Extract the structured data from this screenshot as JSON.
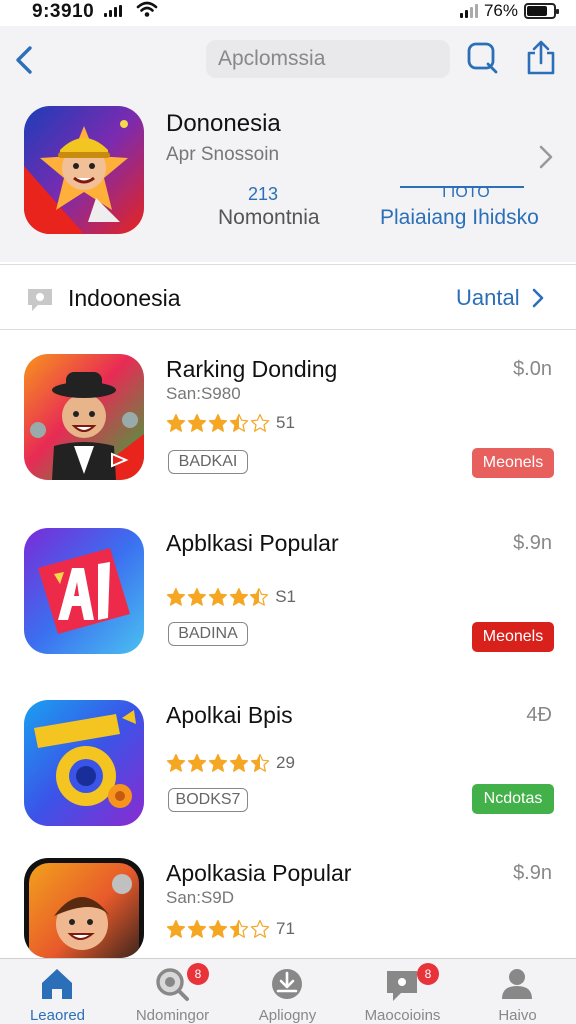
{
  "status_bar": {
    "time": "9:3910",
    "battery_pct": "76%",
    "battery_level": 0.76
  },
  "header": {
    "search_placeholder": "Apclomssia",
    "app_title": "Dononesia",
    "app_subtitle": "Apr Snossoin",
    "stat_number": "213",
    "stat_label": "Nomontnia",
    "stat_number_2": "I IOTO",
    "stat_link": "Plaiaiang Ihidsko"
  },
  "section": {
    "title": "Indoonesia",
    "link": "Uantal"
  },
  "apps": [
    {
      "name": "Rarking Donding",
      "subtitle": "San:S980",
      "price": "$.0n",
      "rating": 3.5,
      "rating_count": "51",
      "badge": "BADKAI",
      "action": "Meonels",
      "action_color": "#e8605e"
    },
    {
      "name": "Apblkasi Popular",
      "subtitle": "",
      "price": "$.9n",
      "rating": 4.5,
      "rating_count": "S1",
      "badge": "BADINA",
      "action": "Meonels",
      "action_color": "#d9211c"
    },
    {
      "name": "Apolkai Bpis",
      "subtitle": "",
      "price": "4Ð",
      "rating": 4.5,
      "rating_count": "29",
      "badge": "BODKS7",
      "action": "Ncdotas",
      "action_color": "#43b14a"
    },
    {
      "name": "Apolkasia Popular",
      "subtitle": "San:S9D",
      "price": "$.9n",
      "rating": 3.5,
      "rating_count": "71",
      "badge": "",
      "action": "",
      "action_color": "#e8605e"
    }
  ],
  "tabs": [
    {
      "label": "Leaored",
      "badge": "",
      "active": true
    },
    {
      "label": "Ndomingor",
      "badge": "8",
      "active": false
    },
    {
      "label": "Apliogny",
      "badge": "",
      "active": false
    },
    {
      "label": "Maocoioins",
      "badge": "8",
      "active": false
    },
    {
      "label": "Haivo",
      "badge": "",
      "active": false
    }
  ],
  "colors": {
    "accent": "#2b6fb8",
    "star": "#f5a623",
    "badge_red": "#e8333a"
  }
}
